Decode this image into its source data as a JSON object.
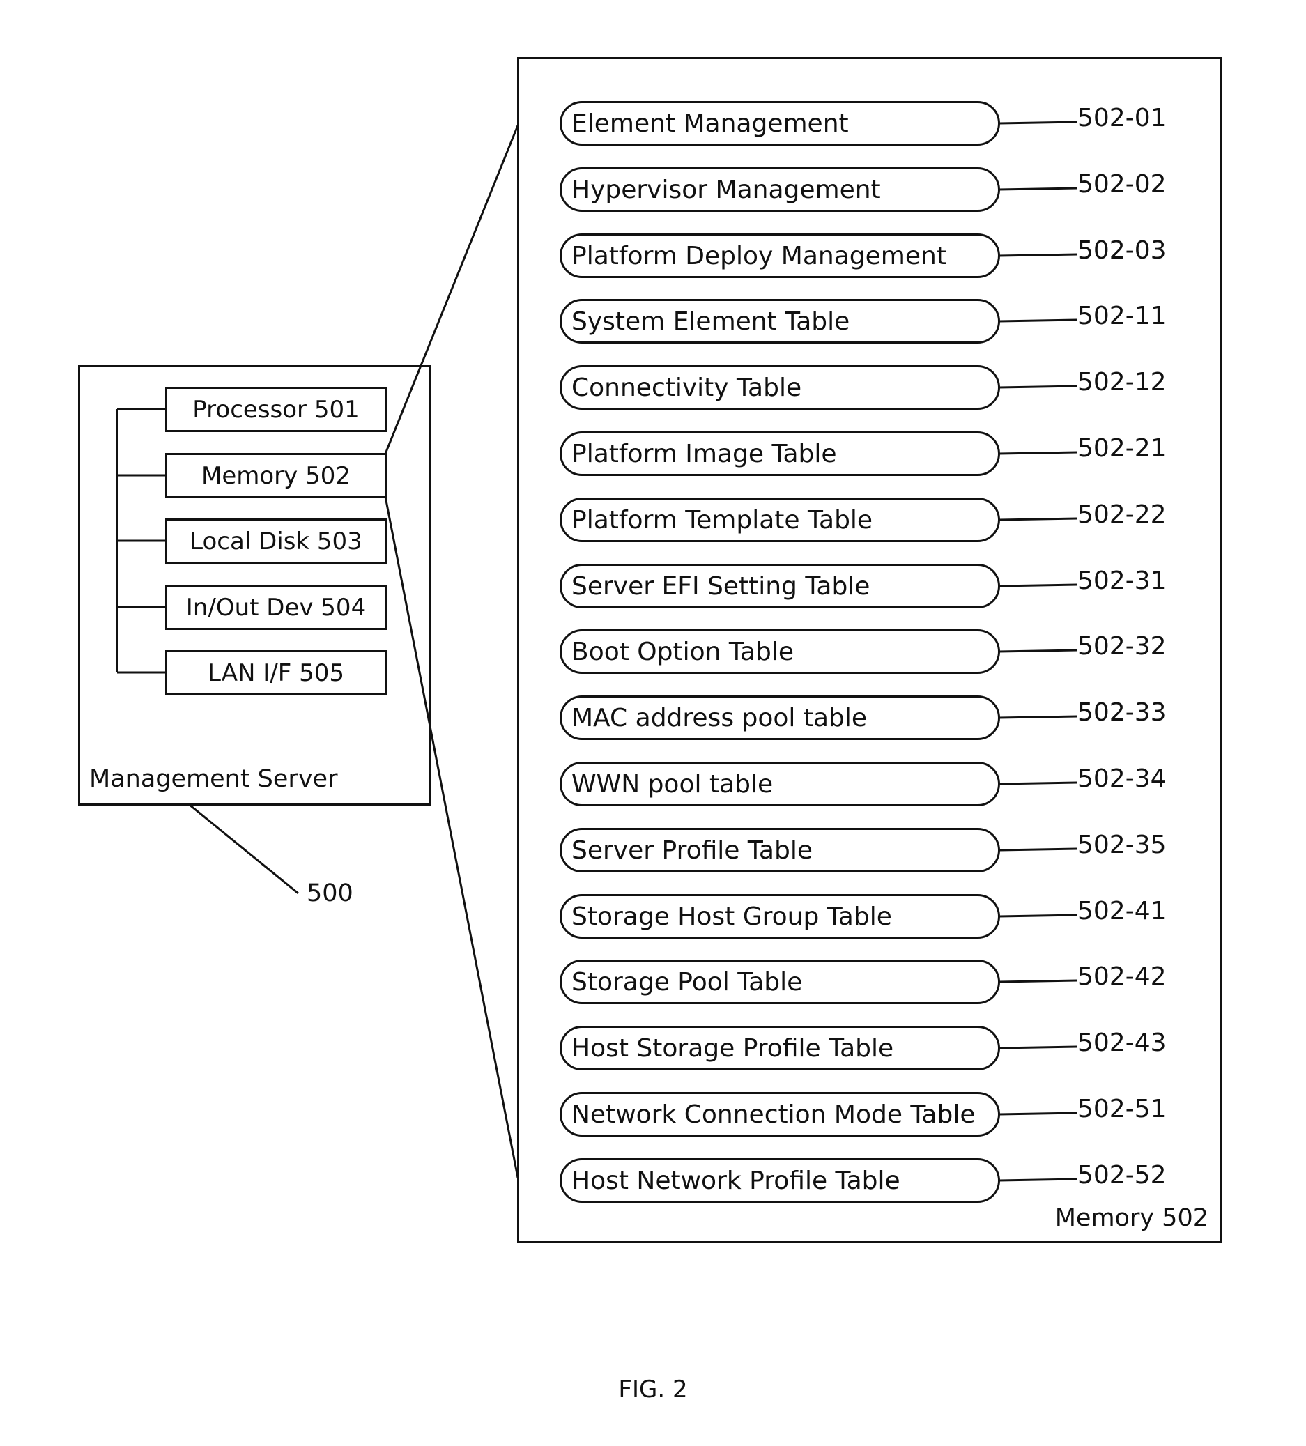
{
  "figure": {
    "caption": "FIG. 2",
    "reference_number": "500"
  },
  "management_server": {
    "label": "Management Server",
    "components": [
      {
        "label": "Processor 501"
      },
      {
        "label": "Memory 502"
      },
      {
        "label": "Local Disk 503"
      },
      {
        "label": "In/Out Dev 504"
      },
      {
        "label": "LAN I/F 505"
      }
    ]
  },
  "memory_detail": {
    "label": "Memory 502",
    "items": [
      {
        "label": "Element Management",
        "ref": "502-01"
      },
      {
        "label": "Hypervisor Management",
        "ref": "502-02"
      },
      {
        "label": "Platform Deploy Management",
        "ref": "502-03"
      },
      {
        "label": "System Element Table",
        "ref": "502-11"
      },
      {
        "label": "Connectivity Table",
        "ref": "502-12"
      },
      {
        "label": "Platform Image Table",
        "ref": "502-21"
      },
      {
        "label": "Platform Template Table",
        "ref": "502-22"
      },
      {
        "label": "Server EFI Setting Table",
        "ref": "502-31"
      },
      {
        "label": "Boot Option Table",
        "ref": "502-32"
      },
      {
        "label": "MAC address pool table",
        "ref": "502-33"
      },
      {
        "label": "WWN pool table",
        "ref": "502-34"
      },
      {
        "label": "Server Profile Table",
        "ref": "502-35"
      },
      {
        "label": "Storage Host Group Table",
        "ref": "502-41"
      },
      {
        "label": "Storage Pool Table",
        "ref": "502-42"
      },
      {
        "label": "Host Storage Profile Table",
        "ref": "502-43"
      },
      {
        "label": "Network Connection Mode Table",
        "ref": "502-51"
      },
      {
        "label": "Host Network Profile Table",
        "ref": "502-52"
      }
    ]
  }
}
